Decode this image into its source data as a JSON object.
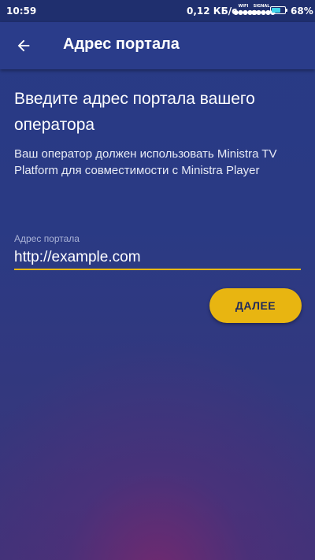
{
  "status_bar": {
    "time": "10:59",
    "speed": "0,12 КБ/с",
    "wifi_label": "WIFI",
    "signal_label": "SIGNAL",
    "battery_level": 0.68,
    "battery_text": "68%",
    "battery_color": "#3fd4ea"
  },
  "app_bar": {
    "back_icon": "arrow-left-icon",
    "title": "Адрес портала"
  },
  "content": {
    "heading": "Введите адрес портала вашего оператора",
    "description": "Ваш оператор должен использовать Ministra TV Platform для совместимости с Ministra Player"
  },
  "portal_field": {
    "label": "Адрес портала",
    "value": "http://example.com"
  },
  "next_button": {
    "label": "ДАЛЕЕ"
  },
  "colors": {
    "accent": "#e8b511",
    "app_bar": "#2a3c8a",
    "background": "#28367a"
  }
}
